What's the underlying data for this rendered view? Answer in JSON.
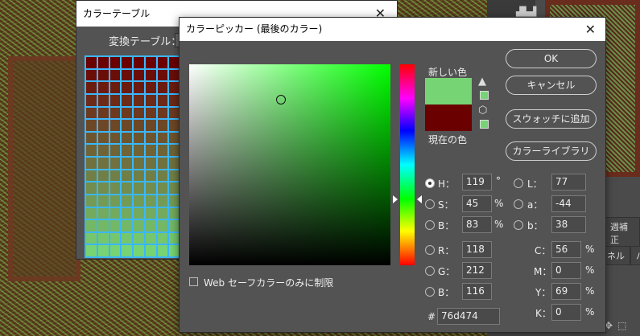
{
  "color_table_dialog": {
    "title": "カラーテーブル",
    "close_glyph": "✕",
    "convert_label": "変換テーブル："
  },
  "background": {
    "right_tab_label_1": "週補正",
    "right_tab_label_2": "ネル",
    "right_tab_label_3": "パ"
  },
  "color_picker": {
    "title": "カラーピッカー (最後のカラー)",
    "close_glyph": "✕",
    "new_label": "新しい色",
    "current_label": "現在の色",
    "new_color": "#76d474",
    "current_color": "#6a0000",
    "hue_color": "#00ff00",
    "buttons": {
      "ok": "OK",
      "cancel": "キャンセル",
      "add_swatch": "スウォッチに追加",
      "color_library": "カラーライブラリ"
    },
    "hsb": {
      "h": {
        "label": "H：",
        "value": "119",
        "unit": "°"
      },
      "s": {
        "label": "S：",
        "value": "45",
        "unit": "%"
      },
      "b": {
        "label": "B：",
        "value": "83",
        "unit": "%"
      }
    },
    "rgb": {
      "r": {
        "label": "R：",
        "value": "118"
      },
      "g": {
        "label": "G：",
        "value": "212"
      },
      "b": {
        "label": "B：",
        "value": "116"
      }
    },
    "lab": {
      "l": {
        "label": "L：",
        "value": "77"
      },
      "a": {
        "label": "a：",
        "value": "-44"
      },
      "b": {
        "label": "b：",
        "value": "38"
      }
    },
    "cmyk": {
      "c": {
        "label": "C：",
        "value": "56",
        "unit": "%"
      },
      "m": {
        "label": "M：",
        "value": "0",
        "unit": "%"
      },
      "y": {
        "label": "Y：",
        "value": "69",
        "unit": "%"
      },
      "k": {
        "label": "K：",
        "value": "0",
        "unit": "%"
      }
    },
    "hex": {
      "label": "#",
      "value": "76d474"
    },
    "web_only_label": "Web セーフカラーのみに制限"
  }
}
